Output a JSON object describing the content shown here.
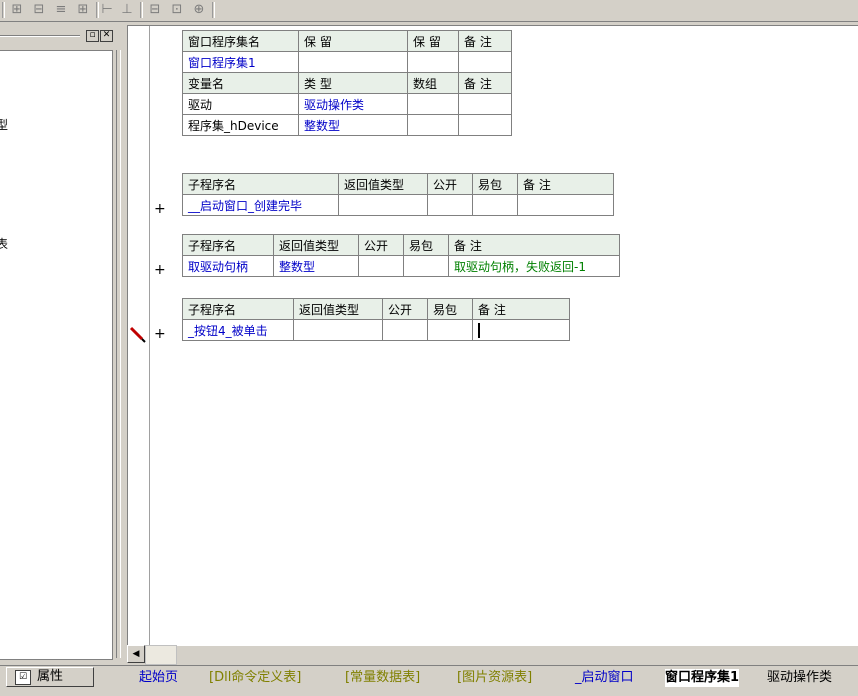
{
  "toolbar": {
    "icons": [
      "split-cell-icon",
      "insert-row-icon",
      "align-icon",
      "table-icon",
      "align-left-icon",
      "align-center-icon",
      "expand-icon",
      "height-icon",
      "merge-icon"
    ]
  },
  "left_panel": {
    "items": [
      {
        "text": "型"
      },
      {
        "text": "表"
      }
    ]
  },
  "assembly_table": {
    "headers": [
      "窗口程序集名",
      "保 留",
      "保 留",
      "备 注"
    ],
    "row": [
      "窗口程序集1",
      "",
      "",
      ""
    ],
    "var_headers": [
      "变量名",
      "类 型",
      "数组",
      "备 注"
    ],
    "vars": [
      [
        "驱动",
        "驱动操作类",
        "",
        ""
      ],
      [
        "程序集_hDevice",
        "整数型",
        "",
        ""
      ]
    ]
  },
  "subs": [
    {
      "headers": [
        "子程序名",
        "返回值类型",
        "公开",
        "易包",
        "备 注"
      ],
      "row": [
        "__启动窗口_创建完毕",
        "",
        "",
        "",
        ""
      ]
    },
    {
      "headers": [
        "子程序名",
        "返回值类型",
        "公开",
        "易包",
        "备 注"
      ],
      "row": [
        "取驱动句柄",
        "整数型",
        "",
        "",
        "取驱动句柄，失败返回-1"
      ]
    },
    {
      "headers": [
        "子程序名",
        "返回值类型",
        "公开",
        "易包",
        "备 注"
      ],
      "row": [
        "_按钮4_被单击",
        "",
        "",
        "",
        ""
      ]
    }
  ],
  "gutter": {
    "plus": "+"
  },
  "bottom": {
    "properties_label": "属性",
    "tabs": [
      "起始页",
      "[Dll命令定义表]",
      "[常量数据表]",
      "[图片资源表]",
      "_启动窗口",
      "窗口程序集1",
      "驱动操作类"
    ]
  }
}
